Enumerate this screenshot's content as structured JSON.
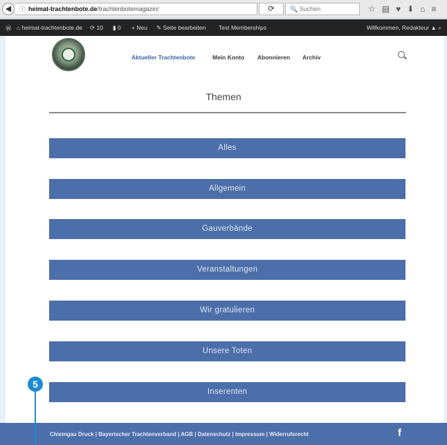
{
  "browser": {
    "url_host": "heimat-trachtenbote.de",
    "url_path": "/trachtenbotemagazin/",
    "search_placeholder": "Suchen"
  },
  "admin_bar": {
    "site_name": "heimat-trachtenbote.de",
    "updates": "10",
    "comments": "0",
    "new_label": "Neu",
    "edit_label": "Seite bearbeiten",
    "memberships_label": "Test Memberships",
    "welcome": "Willkommen, Redakteur"
  },
  "nav": {
    "items": [
      "Aktueller Trachtenbote",
      "Mein Konto",
      "Abonnieren",
      "Archiv"
    ]
  },
  "page": {
    "title": "Themen",
    "topics": [
      "Alles",
      "Allgemein",
      "Gauverbände",
      "Veranstaltungen",
      "Wir gratulieren",
      "Unsere Toten",
      "Inserenten"
    ]
  },
  "callout": {
    "number": "5"
  },
  "footer": {
    "links": "Chiemgau Druck | Bayerischer Trachtenverband | AGB | Datenschutz | Impressum | Widerrufsrecht",
    "social": "f"
  },
  "colors": {
    "accent_blue": "#4c6ea9",
    "nav_active": "#3a62a5",
    "callout_blue": "#1e8ad0",
    "admin_bar": "#232323"
  },
  "icons": {
    "back": "back-arrow-icon",
    "info": "info-icon",
    "reload": "reload-icon",
    "search": "search-icon",
    "wordpress": "wordpress-icon",
    "facebook": "facebook-icon"
  }
}
